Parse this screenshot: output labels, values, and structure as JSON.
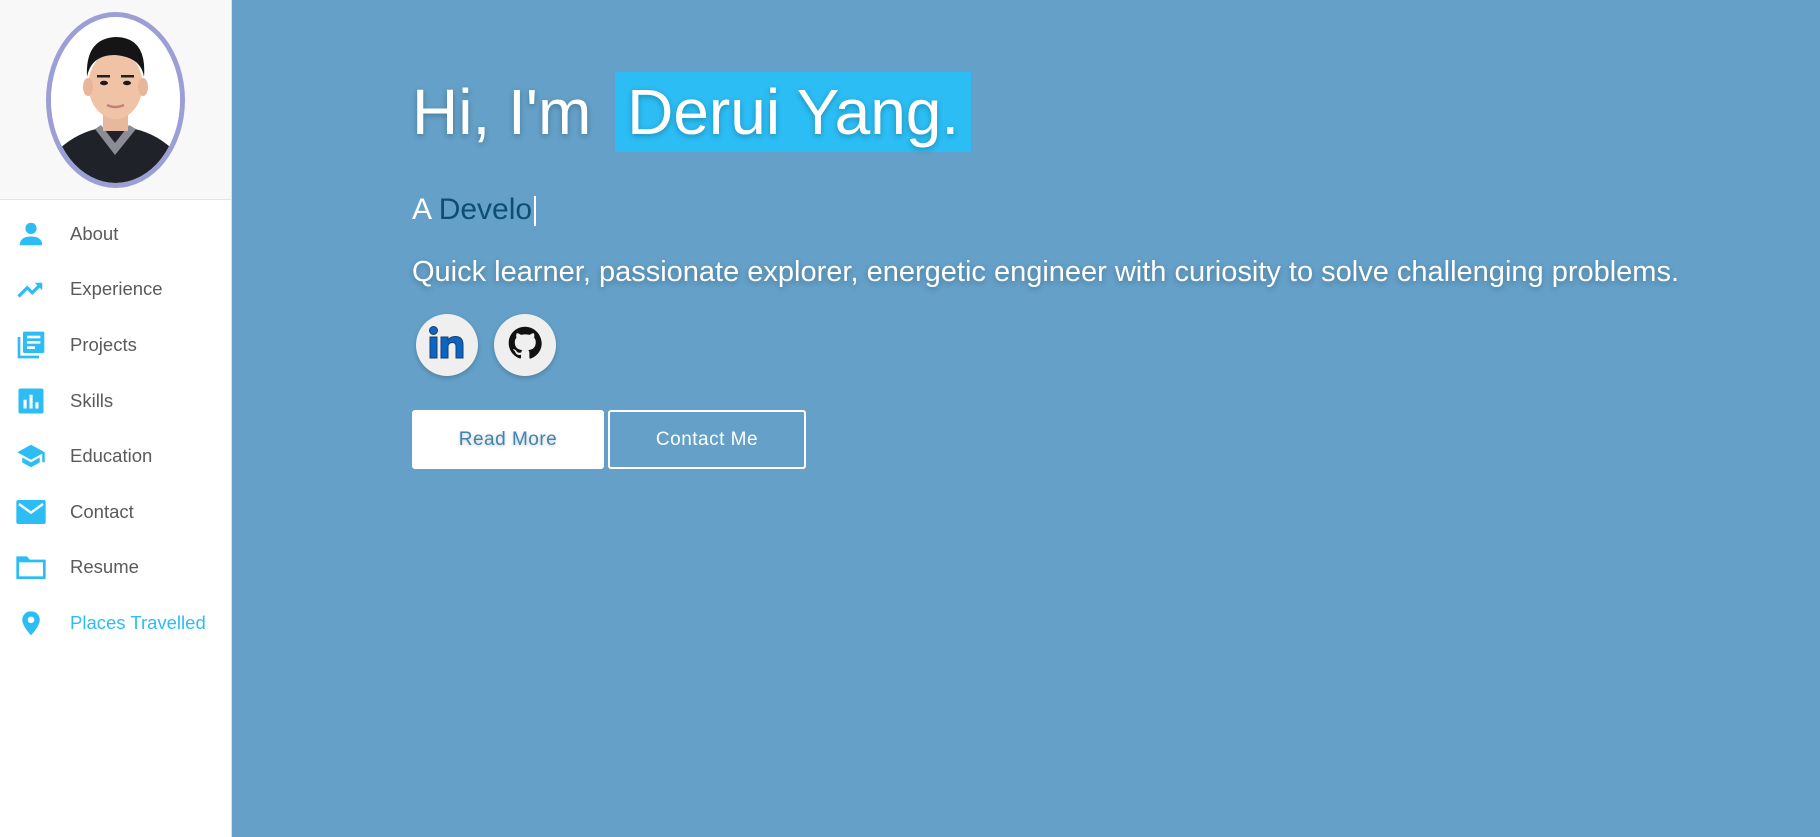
{
  "sidebar": {
    "items": [
      {
        "label": "About",
        "icon": "person-icon"
      },
      {
        "label": "Experience",
        "icon": "trending-up-icon"
      },
      {
        "label": "Projects",
        "icon": "library-books-icon"
      },
      {
        "label": "Skills",
        "icon": "bar-chart-icon"
      },
      {
        "label": "Education",
        "icon": "graduation-cap-icon"
      },
      {
        "label": "Contact",
        "icon": "mail-icon"
      },
      {
        "label": "Resume",
        "icon": "folder-icon"
      },
      {
        "label": "Places Travelled",
        "icon": "location-pin-icon"
      }
    ],
    "active_item": "Places Travelled"
  },
  "hero": {
    "greeting": "Hi, I'm",
    "name": "Derui Yang.",
    "typed_prefix": "A",
    "typed_word": "Develo",
    "tagline": "Quick learner, passionate explorer, energetic engineer with curiosity to solve challenging problems."
  },
  "socials": [
    {
      "name": "LinkedIn",
      "icon": "linkedin-icon"
    },
    {
      "name": "GitHub",
      "icon": "github-icon"
    }
  ],
  "buttons": {
    "read_more": "Read More",
    "contact_me": "Contact Me"
  },
  "colors": {
    "accent": "#2bbdf4",
    "background": "#64a0c8",
    "avatar_border": "#9b9fd6",
    "typed_word": "#0d4f71"
  }
}
